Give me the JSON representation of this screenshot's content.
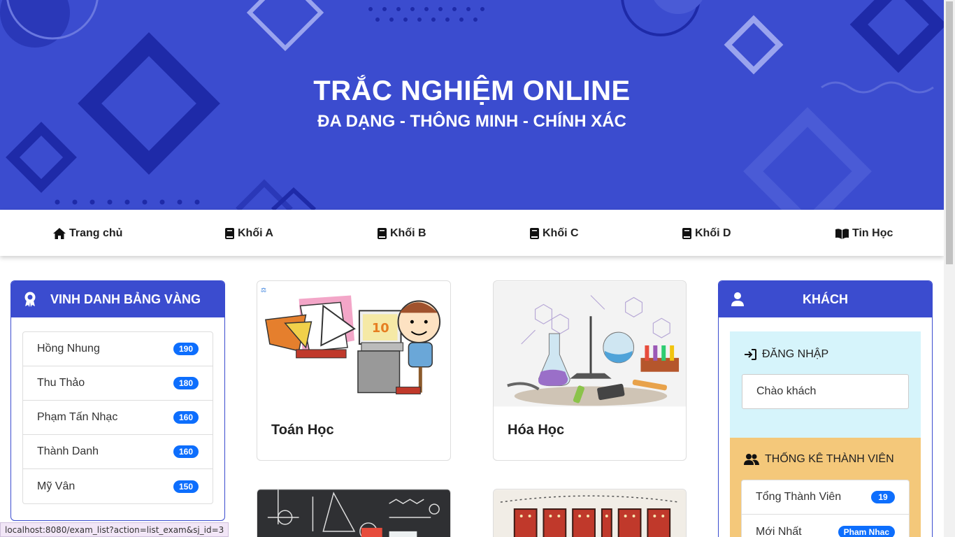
{
  "hero": {
    "title": "TRẮC NGHIỆM ONLINE",
    "subtitle": "ĐA DẠNG - THÔNG MINH - CHÍNH XÁC",
    "bg_color": "#3b4ccf"
  },
  "nav": {
    "items": [
      {
        "label": "Trang chủ",
        "icon": "home-icon"
      },
      {
        "label": "Khối A",
        "icon": "book-icon"
      },
      {
        "label": "Khối B",
        "icon": "book-icon"
      },
      {
        "label": "Khối C",
        "icon": "book-icon"
      },
      {
        "label": "Khối D",
        "icon": "book-icon"
      },
      {
        "label": "Tin Học",
        "icon": "open-book-icon"
      }
    ]
  },
  "leaderboard": {
    "title": "VINH DANH BẢNG VÀNG",
    "icon": "award-icon",
    "rows": [
      {
        "name": "Hồng Nhung",
        "score": "190"
      },
      {
        "name": "Thu Thảo",
        "score": "180"
      },
      {
        "name": "Phạm Tấn Nhạc",
        "score": "160"
      },
      {
        "name": "Thành Danh",
        "score": "160"
      },
      {
        "name": "Mỹ Vân",
        "score": "150"
      }
    ]
  },
  "subjects": [
    {
      "title": "Toán Học",
      "image": "math-illustration"
    },
    {
      "title": "Hóa Học",
      "image": "chemistry-illustration"
    },
    {
      "title": "",
      "image": "physics-illustration"
    },
    {
      "title": "",
      "image": "english-illustration"
    }
  ],
  "guest_panel": {
    "title": "KHÁCH",
    "icon": "user-icon",
    "login": {
      "title": "ĐĂNG NHẬP",
      "icon": "login-icon",
      "greeting": "Chào khách"
    },
    "stats": {
      "title": "THỐNG KÊ THÀNH VIÊN",
      "icon": "users-icon",
      "rows": [
        {
          "label": "Tổng Thành Viên",
          "value": "19"
        },
        {
          "label": "Mới Nhất",
          "value": "Pham Nhac"
        }
      ]
    }
  },
  "status_bar": {
    "url": "localhost:8080/exam_list?action=list_exam&sj_id=3"
  }
}
